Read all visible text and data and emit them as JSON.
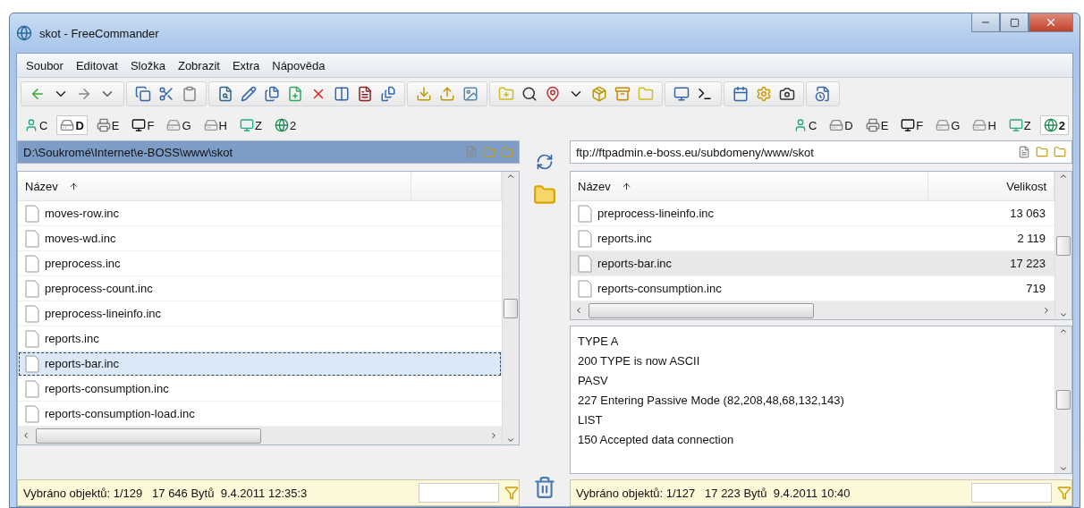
{
  "window": {
    "title": "skot - FreeCommander"
  },
  "menu": [
    {
      "label": "Soubor"
    },
    {
      "label": "Editovat"
    },
    {
      "label": "Složka"
    },
    {
      "label": "Zobrazit"
    },
    {
      "label": "Extra"
    },
    {
      "label": "Nápověda"
    }
  ],
  "panels": [
    {
      "active": true,
      "drives": [
        {
          "label": "C",
          "selected": false
        },
        {
          "label": "D",
          "selected": true
        },
        {
          "label": "E",
          "selected": false
        },
        {
          "label": "F",
          "selected": false
        },
        {
          "label": "G",
          "selected": false
        },
        {
          "label": "H",
          "selected": false
        },
        {
          "label": "Z",
          "selected": false
        },
        {
          "label": "2",
          "selected": false
        }
      ],
      "path": "D:\\Soukromé\\Internet\\e-BOSS\\www\\skot",
      "columns": [
        {
          "label": "Název",
          "sorted": true
        }
      ],
      "rows": [
        {
          "name": "moves-row.inc",
          "selected": false
        },
        {
          "name": "moves-wd.inc",
          "selected": false
        },
        {
          "name": "preprocess.inc",
          "selected": false
        },
        {
          "name": "preprocess-count.inc",
          "selected": false
        },
        {
          "name": "preprocess-lineinfo.inc",
          "selected": false
        },
        {
          "name": "reports.inc",
          "selected": false
        },
        {
          "name": "reports-bar.inc",
          "selected": true
        },
        {
          "name": "reports-consumption.inc",
          "selected": false
        },
        {
          "name": "reports-consumption-load.inc",
          "selected": false
        }
      ],
      "status": "Vybráno objektů: 1/129   17 646 Bytů  9.4.2011 12:35:3"
    },
    {
      "active": false,
      "drives": [
        {
          "label": "C",
          "selected": false
        },
        {
          "label": "D",
          "selected": false
        },
        {
          "label": "E",
          "selected": false
        },
        {
          "label": "F",
          "selected": false
        },
        {
          "label": "G",
          "selected": false
        },
        {
          "label": "H",
          "selected": false
        },
        {
          "label": "Z",
          "selected": false
        },
        {
          "label": "2",
          "selected": true
        }
      ],
      "path": "ftp://ftpadmin.e-boss.eu/subdomeny/www/skot",
      "columns": [
        {
          "label": "Název",
          "sorted": true
        },
        {
          "label": "Velikost",
          "sorted": false
        }
      ],
      "rows": [
        {
          "name": "preprocess-lineinfo.inc",
          "size": "13 063",
          "selected": false
        },
        {
          "name": "reports.inc",
          "size": "2 119",
          "selected": false
        },
        {
          "name": "reports-bar.inc",
          "size": "17 223",
          "selected": true
        },
        {
          "name": "reports-consumption.inc",
          "size": "719",
          "selected": false
        }
      ],
      "log": [
        "TYPE A",
        "200 TYPE is now ASCII",
        "PASV",
        "227 Entering Passive Mode (82,208,48,68,132,143)",
        "LIST",
        "150 Accepted data connection"
      ],
      "status": "Vybráno objektů: 1/127   17 223 Bytů  9.4.2011 10:40"
    }
  ]
}
